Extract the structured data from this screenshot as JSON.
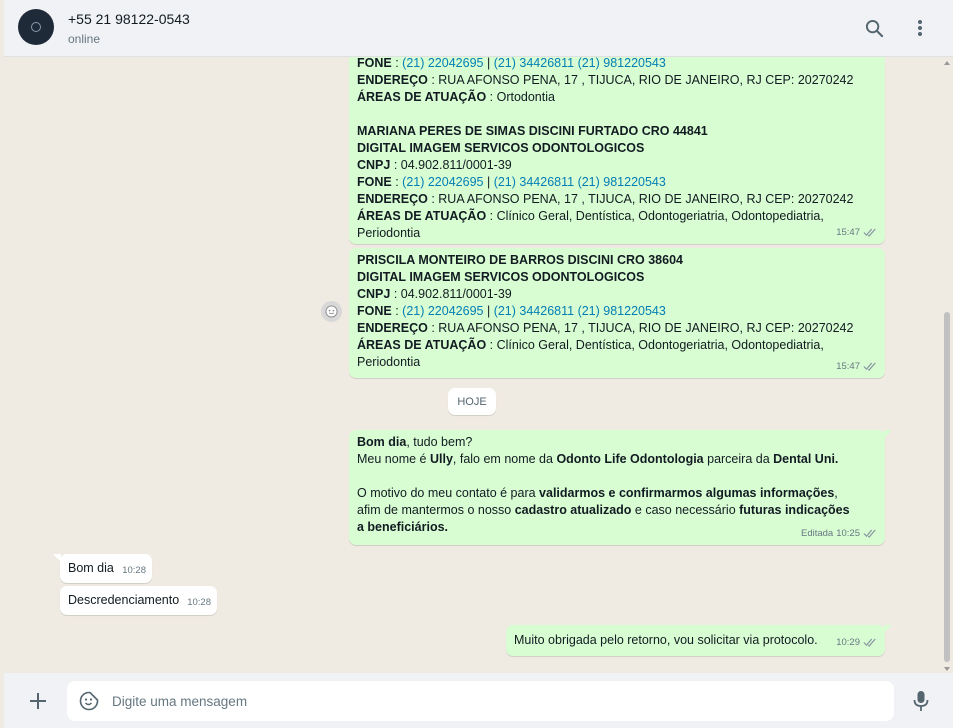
{
  "header": {
    "contact_name": "+55 21 98122-0543",
    "status": "online",
    "search_icon": "search-icon",
    "menu_icon": "kebab-menu-icon"
  },
  "colors": {
    "outgoing_bubble": "#d9fdd3",
    "incoming_bubble": "#ffffff",
    "link": "#027eb5",
    "chat_background": "#efeae2"
  },
  "messages": {
    "m1": {
      "fone_label": "FONE",
      "fone_sep": " : ",
      "phone1": "(21) 22042695",
      "pipe": " | ",
      "phone2": "(21) 34426811",
      "phone3": "(21) 981220543",
      "end_label": "ENDEREÇO",
      "end_sep": " : ",
      "end_value": "RUA AFONSO PENA, 17 , TIJUCA, RIO DE JANEIRO, RJ CEP: 20270242",
      "areas_label": "ÁREAS DE ATUAÇÃO",
      "areas_sep": " : ",
      "areas_value": "Ortodontia",
      "name": "MARIANA PERES DE SIMAS DISCINI FURTADO CRO 44841",
      "company": "DIGITAL IMAGEM SERVICOS ODONTOLOGICOS",
      "cnpj_label": "CNPJ",
      "cnpj_sep": " : ",
      "cnpj_value": "04.902.811/0001-39",
      "fone2_label": "FONE",
      "fone2_sep": " : ",
      "m_phone1": "(21) 22042695",
      "m_pipe": " | ",
      "m_phone2": "(21) 34426811",
      "m_phone3": "(21) 981220543",
      "end2_label": "ENDEREÇO",
      "end2_sep": " : ",
      "end2_value": "RUA AFONSO PENA, 17 , TIJUCA, RIO DE JANEIRO, RJ CEP: 20270242",
      "areas2_label": "ÁREAS DE ATUAÇÃO",
      "areas2_sep": " : ",
      "areas2_value": "Clínico Geral, Dentística, Odontogeriatria, Odontopediatria, Periodontia",
      "time": "15:47"
    },
    "m2": {
      "name": "PRISCILA MONTEIRO DE BARROS DISCINI CRO 38604",
      "company": "DIGITAL IMAGEM SERVICOS ODONTOLOGICOS",
      "cnpj_label": "CNPJ",
      "cnpj_sep": " : ",
      "cnpj_value": "04.902.811/0001-39",
      "fone_label": "FONE",
      "fone_sep": " : ",
      "phone1": "(21) 22042695",
      "pipe": " | ",
      "phone2": "(21) 34426811",
      "phone3": "(21) 981220543",
      "end_label": "ENDEREÇO",
      "end_sep": " : ",
      "end_value": "RUA AFONSO PENA, 17 , TIJUCA, RIO DE JANEIRO, RJ CEP: 20270242",
      "areas_label": "ÁREAS DE ATUAÇÃO",
      "areas_sep": " : ",
      "areas_value": "Clínico Geral, Dentística, Odontogeriatria, Odontopediatria, Periodontia",
      "time": "15:47"
    },
    "day_separator": "HOJE",
    "m3": {
      "greet_bold": "Bom dia",
      "greet_rest": ", tudo bem?",
      "l2_a": "Meu nome é ",
      "l2_name": "Ully",
      "l2_b": ", falo em nome da ",
      "l2_company": "Odonto Life Odontologia",
      "l2_c": " parceira da ",
      "l2_partner": "Dental Uni.",
      "p2_a": "O motivo do meu contato é para ",
      "p2_bold1": "validarmos e confirmarmos algumas informações",
      "p2_b": ", afim de mantermos o nosso ",
      "p2_bold2": "cadastro atualizado",
      "p2_c": " e caso necessário ",
      "p2_bold3": "futuras indicações a beneficiários.",
      "edited": "Editada",
      "time": "10:25"
    },
    "m4": {
      "text": "Bom dia",
      "time": "10:28"
    },
    "m5": {
      "text": "Descredenciamento",
      "time": "10:28"
    },
    "m6": {
      "text": "Muito obrigada pelo retorno, vou solicitar via protocolo.",
      "time": "10:29"
    }
  },
  "composer": {
    "placeholder": "Digite uma mensagem",
    "attach_icon": "plus-icon",
    "sticker_icon": "sticker-icon",
    "mic_icon": "microphone-icon"
  }
}
